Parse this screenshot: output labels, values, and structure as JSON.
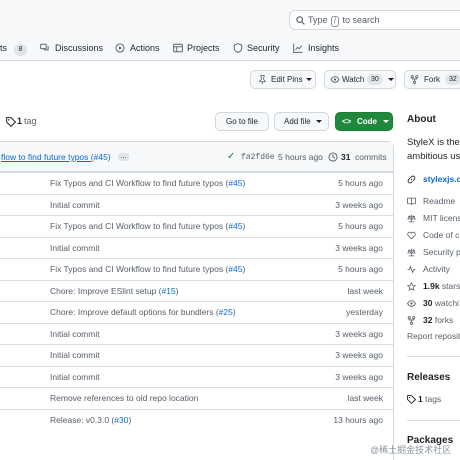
{
  "search": {
    "pre": "Type",
    "key": "/",
    "post": "to search"
  },
  "nav": {
    "issues_label": "ts",
    "issues_count": "8",
    "discussions": "Discussions",
    "actions": "Actions",
    "projects": "Projects",
    "security": "Security",
    "insights": "Insights"
  },
  "repo_actions": {
    "edit_pins": "Edit Pins",
    "watch": "Watch",
    "watch_count": "30",
    "fork": "Fork",
    "fork_count": "32"
  },
  "toolbar": {
    "tags_count": "1",
    "tags_label": "tag",
    "go_to_file": "Go to file",
    "add_file": "Add file",
    "code": "Code"
  },
  "latest_commit": {
    "message": "flow to find future typos (",
    "pr": "#45",
    "pr_close": ")",
    "ellipsis": "…",
    "hash": "fa2fd6e",
    "time": "5 hours ago",
    "commits_count": "31",
    "commits_label": "commits"
  },
  "files": [
    {
      "msg": "Fix Typos and CI Workflow to find future typos (",
      "pr": "#45",
      "end": ")",
      "date": "5 hours ago"
    },
    {
      "msg": "Initial commit",
      "pr": "",
      "end": "",
      "date": "3 weeks ago"
    },
    {
      "msg": "Fix Typos and CI Workflow to find future typos (",
      "pr": "#45",
      "end": ")",
      "date": "5 hours ago"
    },
    {
      "msg": "Initial commit",
      "pr": "",
      "end": "",
      "date": "3 weeks ago"
    },
    {
      "msg": "Fix Typos and CI Workflow to find future typos (",
      "pr": "#45",
      "end": ")",
      "date": "5 hours ago"
    },
    {
      "msg": "Chore: Improve ESlint setup (",
      "pr": "#15",
      "end": ")",
      "date": "last week"
    },
    {
      "msg": "Chore: Improve default options for bundlers (",
      "pr": "#25",
      "end": ")",
      "date": "yesterday"
    },
    {
      "msg": "Initial commit",
      "pr": "",
      "end": "",
      "date": "3 weeks ago"
    },
    {
      "msg": "Initial commit",
      "pr": "",
      "end": "",
      "date": "3 weeks ago"
    },
    {
      "msg": "Initial commit",
      "pr": "",
      "end": "",
      "date": "3 weeks ago"
    },
    {
      "msg": "Remove references to old repo location",
      "pr": "",
      "end": "",
      "date": "last week"
    },
    {
      "msg": "Release: v0.3.0 (",
      "pr": "#30",
      "end": ")",
      "date": "13 hours ago"
    }
  ],
  "about": {
    "title": "About",
    "desc1": "StyleX is the",
    "desc2": "ambitious us",
    "website": "stylexjs.co",
    "readme": "Readme",
    "license": "MIT licens",
    "code_of_conduct": "Code of c",
    "security_policy": "Security p",
    "activity": "Activity",
    "stars_count": "1.9k",
    "stars_label": "stars",
    "watching_count": "30",
    "watching_label": "watchi",
    "forks_count": "32",
    "forks_label": "forks",
    "report": "Report reposit"
  },
  "releases": {
    "title": "Releases",
    "count": "1",
    "label": "tags"
  },
  "packages": {
    "title": "Packages"
  },
  "watermark": "@稀土掘金技术社区",
  "colors": {
    "accent": "#0969da",
    "code_button": "#1f883d",
    "muted": "#57606a",
    "border": "#d0d7de"
  }
}
